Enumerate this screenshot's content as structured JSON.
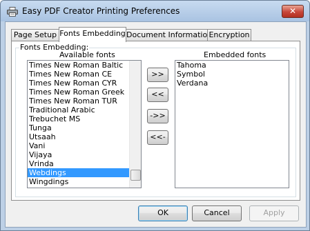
{
  "window": {
    "title": "Easy PDF Creator Printing Preferences",
    "close_label": "✕"
  },
  "tabs": [
    {
      "label": "Page Setup"
    },
    {
      "label": "Fonts Embedding"
    },
    {
      "label": "Document Information"
    },
    {
      "label": "Encryption"
    }
  ],
  "active_tab": "Fonts Embedding",
  "fonts_embedding": {
    "group_label": "Fonts Embedding:",
    "available_label": "Available fonts",
    "embedded_label": "Embedded fonts",
    "available_fonts": [
      "Times New Roman Baltic",
      "Times New Roman CE",
      "Times New Roman CYR",
      "Times New Roman Greek",
      "Times New Roman TUR",
      "Traditional Arabic",
      "Trebuchet MS",
      "Tunga",
      "Utsaah",
      "Vani",
      "Vijaya",
      "Vrinda",
      "Webdings",
      "Wingdings"
    ],
    "selected_available": "Webdings",
    "available_scroll_position": 0.95,
    "embedded_fonts": [
      "Tahoma",
      "Symbol",
      "Verdana"
    ],
    "buttons": {
      "add": ">>",
      "remove": "<<",
      "add_all": "->>",
      "remove_all": "<<-"
    }
  },
  "footer": {
    "ok": "OK",
    "cancel": "Cancel",
    "apply": "Apply"
  }
}
